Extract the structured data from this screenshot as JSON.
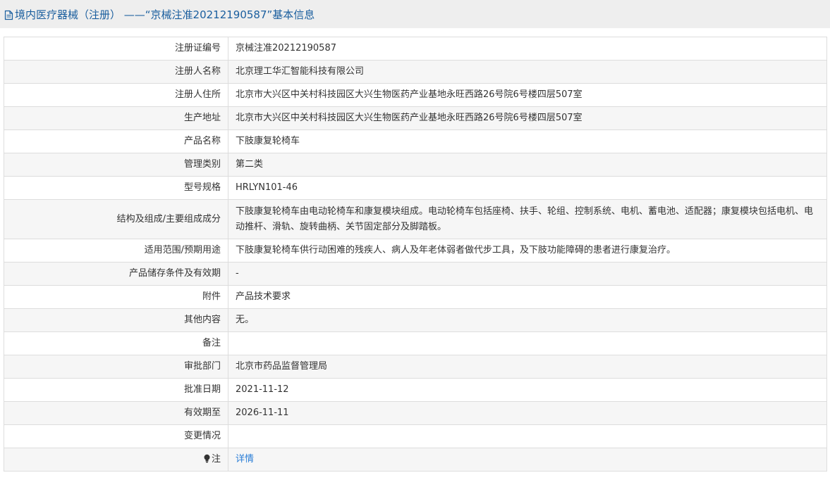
{
  "header": {
    "title": "境内医疗器械（注册）  ——“京械注准20212190587”基本信息",
    "icon": "document-icon"
  },
  "rows": [
    {
      "label": "注册证编号",
      "value": "京械注准20212190587"
    },
    {
      "label": "注册人名称",
      "value": "北京理工华汇智能科技有限公司"
    },
    {
      "label": "注册人住所",
      "value": "北京市大兴区中关村科技园区大兴生物医药产业基地永旺西路26号院6号楼四层507室"
    },
    {
      "label": "生产地址",
      "value": "北京市大兴区中关村科技园区大兴生物医药产业基地永旺西路26号院6号楼四层507室"
    },
    {
      "label": "产品名称",
      "value": "下肢康复轮椅车"
    },
    {
      "label": "管理类别",
      "value": "第二类"
    },
    {
      "label": "型号规格",
      "value": "HRLYN101-46"
    },
    {
      "label": "结构及组成/主要组成成分",
      "value": "下肢康复轮椅车由电动轮椅车和康复模块组成。电动轮椅车包括座椅、扶手、轮组、控制系统、电机、蓄电池、适配器；康复模块包括电机、电动推杆、滑轨、旋转曲柄、关节固定部分及脚踏板。"
    },
    {
      "label": "适用范围/预期用途",
      "value": "下肢康复轮椅车供行动困难的残疾人、病人及年老体弱者做代步工具，及下肢功能障碍的患者进行康复治疗。"
    },
    {
      "label": "产品储存条件及有效期",
      "value": "-"
    },
    {
      "label": "附件",
      "value": "产品技术要求"
    },
    {
      "label": "其他内容",
      "value": "无。"
    },
    {
      "label": "备注",
      "value": ""
    },
    {
      "label": "审批部门",
      "value": "北京市药品监督管理局"
    },
    {
      "label": "批准日期",
      "value": "2021-11-12"
    },
    {
      "label": "有效期至",
      "value": "2026-11-11"
    },
    {
      "label": "变更情况",
      "value": ""
    }
  ],
  "note_row": {
    "label": "注",
    "icon": "lightbulb-icon",
    "link_text": "详情"
  },
  "colors": {
    "title": "#1a5e9e",
    "link": "#2a7dd6",
    "border": "#dddddd",
    "row_alt": "#f6f6f6",
    "header_bg": "#eeeeee"
  }
}
